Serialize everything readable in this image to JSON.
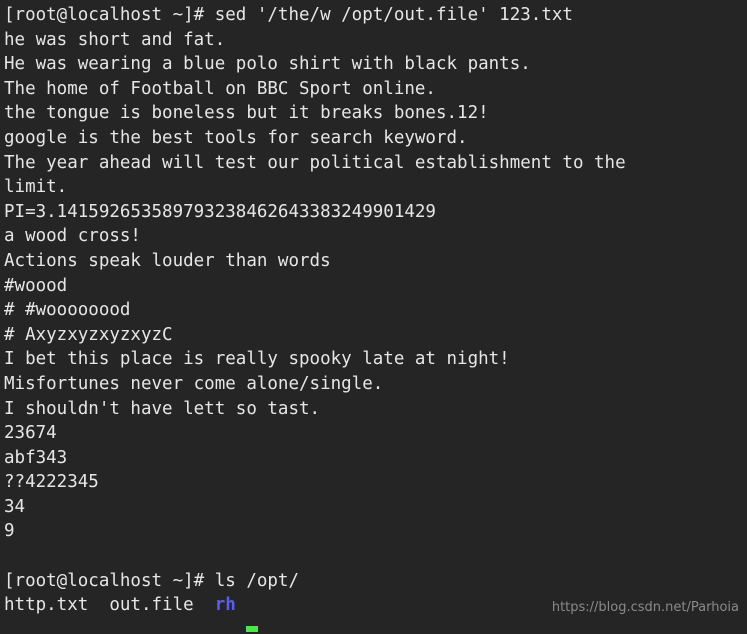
{
  "terminal": {
    "background_color": "#252525",
    "foreground_color": "#e6e6e6",
    "directory_color": "#5c5cf0",
    "cursor_color": "#4ee44e",
    "prompt": "[root@localhost ~]#",
    "lines": [
      {
        "text": "[root@localhost ~]# sed '/the/w /opt/out.file' 123.txt",
        "kind": "command"
      },
      {
        "text": "he was short and fat.",
        "kind": "output"
      },
      {
        "text": "He was wearing a blue polo shirt with black pants.",
        "kind": "output"
      },
      {
        "text": "The home of Football on BBC Sport online.",
        "kind": "output"
      },
      {
        "text": "the tongue is boneless but it breaks bones.12!",
        "kind": "output"
      },
      {
        "text": "google is the best tools for search keyword.",
        "kind": "output"
      },
      {
        "text": "The year ahead will test our political establishment to the",
        "kind": "output"
      },
      {
        "text": "limit.",
        "kind": "output"
      },
      {
        "text": "PI=3.141592653589793238462643383249901429",
        "kind": "output"
      },
      {
        "text": "a wood cross!",
        "kind": "output"
      },
      {
        "text": "Actions speak louder than words",
        "kind": "output"
      },
      {
        "text": "#woood",
        "kind": "output"
      },
      {
        "text": "# #woooooood",
        "kind": "output"
      },
      {
        "text": "# AxyzxyzxyzxyzC",
        "kind": "output"
      },
      {
        "text": "I bet this place is really spooky late at night!",
        "kind": "output"
      },
      {
        "text": "Misfortunes never come alone/single.",
        "kind": "output"
      },
      {
        "text": "I shouldn't have lett so tast.",
        "kind": "output"
      },
      {
        "text": "23674",
        "kind": "output"
      },
      {
        "text": "abf343",
        "kind": "output"
      },
      {
        "text": "??4222345",
        "kind": "output"
      },
      {
        "text": "34",
        "kind": "output"
      },
      {
        "text": "9",
        "kind": "output"
      },
      {
        "text": "",
        "kind": "blank"
      },
      {
        "text": "[root@localhost ~]# ls /opt/",
        "kind": "command"
      }
    ],
    "listing_line": {
      "segments": [
        {
          "text": "http.txt  out.file  ",
          "type": "file"
        },
        {
          "text": "rh",
          "type": "directory"
        }
      ]
    }
  },
  "watermark": {
    "text": "https://blog.csdn.net/Parhoia"
  }
}
